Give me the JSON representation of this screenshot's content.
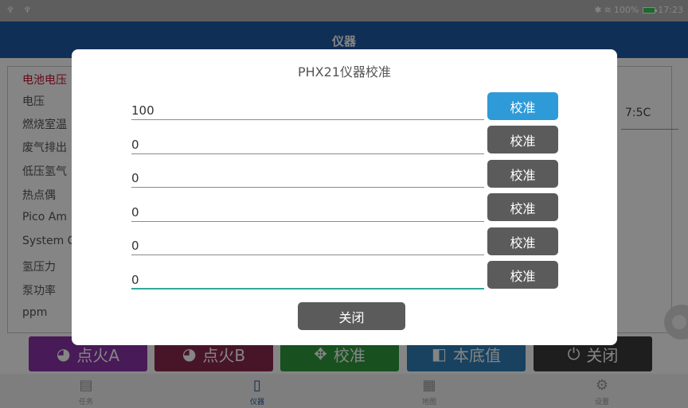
{
  "status_bar": {
    "left_icons": "♆ ♆",
    "bluetooth": "✱",
    "wifi": "≋",
    "battery_pct": "100%",
    "time": "17:23"
  },
  "app_bar": {
    "title": "仪器"
  },
  "background": {
    "rows": [
      {
        "label": "电池电压",
        "red": true
      },
      {
        "label": "电压"
      },
      {
        "label": "燃烧室温"
      },
      {
        "label": "废气排出"
      },
      {
        "label": "低压氢气"
      },
      {
        "label": "热点偶"
      },
      {
        "label": "Pico Am"
      },
      {
        "label": "System C"
      },
      {
        "label": "氢压力"
      },
      {
        "label": "泵功率"
      },
      {
        "label": "ppm"
      }
    ],
    "side_value": "7:5C"
  },
  "buttons": [
    {
      "label": "点火A",
      "icon": "gauge-icon",
      "glyph": "◕",
      "color": "#8a32a8"
    },
    {
      "label": "点火B",
      "icon": "gauge-icon",
      "glyph": "◕",
      "color": "#8a2a4e"
    },
    {
      "label": "校准",
      "icon": "crosshair-icon",
      "glyph": "✥",
      "color": "#2e9a3e"
    },
    {
      "label": "本底值",
      "icon": "grid-icon",
      "glyph": "◧",
      "color": "#2f7fb8"
    },
    {
      "label": "关闭",
      "icon": "power-icon",
      "glyph": "⏻",
      "color": "#3b3b3b"
    }
  ],
  "nav": [
    {
      "label": "任务",
      "icon": "clipboard-icon",
      "glyph": "▤"
    },
    {
      "label": "仪器",
      "icon": "tablet-icon",
      "glyph": "▯",
      "active": true
    },
    {
      "label": "地图",
      "icon": "map-icon",
      "glyph": "▦"
    },
    {
      "label": "设置",
      "icon": "gear-icon",
      "glyph": "⚙"
    }
  ],
  "dialog": {
    "title": "PHX21仪器校准",
    "fields": [
      {
        "value": "100",
        "button": "校准",
        "active": true
      },
      {
        "value": "0",
        "button": "校准"
      },
      {
        "value": "0",
        "button": "校准"
      },
      {
        "value": "0",
        "button": "校准"
      },
      {
        "value": "0",
        "button": "校准"
      },
      {
        "value": "0",
        "button": "校准",
        "focused": true
      }
    ],
    "close_label": "关闭"
  },
  "colors": {
    "app_bar": "#1f5aa5",
    "active_button": "#2f9ad8",
    "dialog_button": "#5b5b5b",
    "focus_underline": "#2fa89a",
    "status_bar": "#b5b5b5"
  }
}
